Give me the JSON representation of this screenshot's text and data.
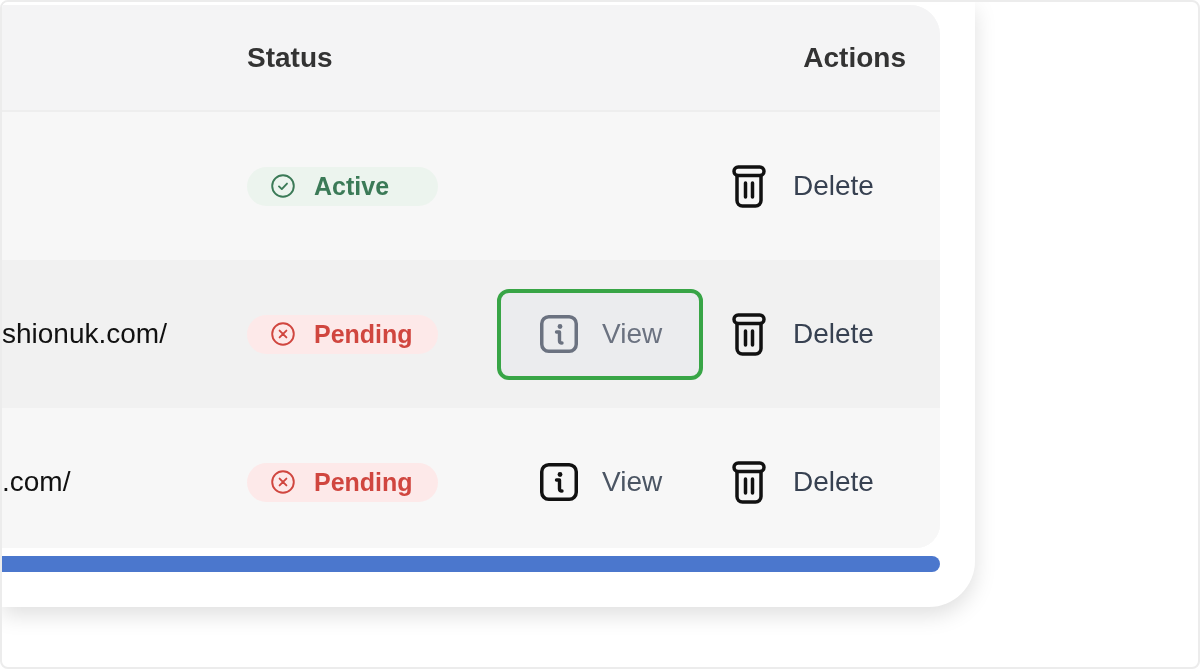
{
  "table": {
    "columns": [
      {
        "label": "Status"
      },
      {
        "label": "Actions"
      }
    ],
    "rows": [
      {
        "status": {
          "kind": "active",
          "label": "Active"
        },
        "delete": {
          "label": "Delete"
        }
      },
      {
        "column_1": "shionuk.com/",
        "status": {
          "kind": "pending",
          "label": "Pending"
        },
        "view": {
          "label": "View",
          "focused": true
        },
        "delete": {
          "label": "Delete"
        }
      },
      {
        "column_1": ".com/",
        "status": {
          "kind": "pending",
          "label": "Pending"
        },
        "view": {
          "label": "View",
          "focused": false
        },
        "delete": {
          "label": "Delete"
        }
      }
    ]
  }
}
